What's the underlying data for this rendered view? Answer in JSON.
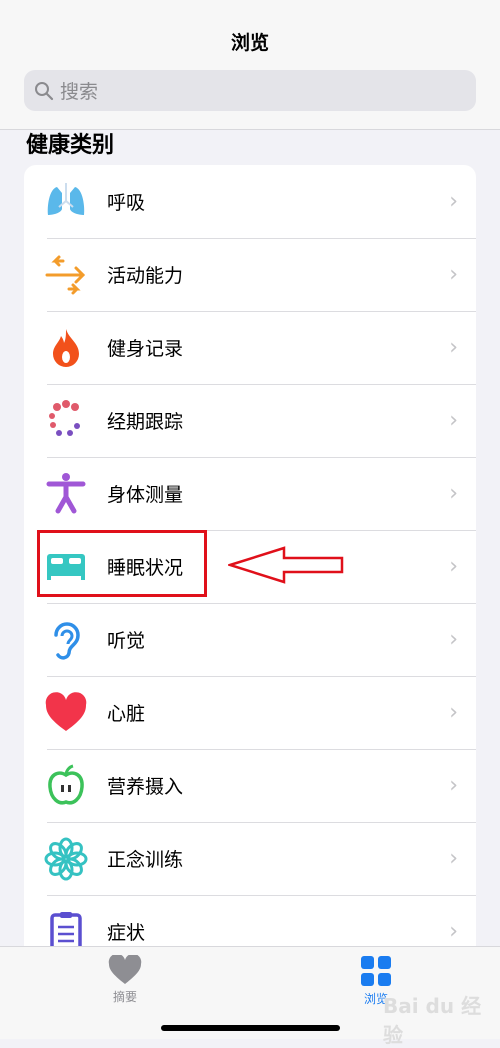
{
  "header": {
    "title": "浏览",
    "search_placeholder": "搜索"
  },
  "section_title": "健康类别",
  "categories": [
    {
      "label": "呼吸",
      "icon": "lungs-icon",
      "color": "#5ab8ea"
    },
    {
      "label": "活动能力",
      "icon": "arrows-icon",
      "color": "#f39c2b"
    },
    {
      "label": "健身记录",
      "icon": "flame-icon",
      "color": "#f2511b"
    },
    {
      "label": "经期跟踪",
      "icon": "cycle-dots-icon",
      "color": "#e05a6b"
    },
    {
      "label": "身体测量",
      "icon": "figure-icon",
      "color": "#a057d6"
    },
    {
      "label": "睡眠状况",
      "icon": "bed-icon",
      "color": "#35c7c2"
    },
    {
      "label": "听觉",
      "icon": "ear-icon",
      "color": "#2f8fe8"
    },
    {
      "label": "心脏",
      "icon": "heart-icon",
      "color": "#f2344a"
    },
    {
      "label": "营养摄入",
      "icon": "apple-icon",
      "color": "#3cc25a"
    },
    {
      "label": "正念训练",
      "icon": "flower-icon",
      "color": "#35c2c2"
    },
    {
      "label": "症状",
      "icon": "clipboard-icon",
      "color": "#5b4fd0"
    }
  ],
  "tabs": [
    {
      "label": "摘要",
      "icon": "heart-icon",
      "active": false
    },
    {
      "label": "浏览",
      "icon": "grid-icon",
      "active": true
    }
  ],
  "annotation": {
    "color": "#e0101a"
  },
  "watermark": "Bai du 经验"
}
